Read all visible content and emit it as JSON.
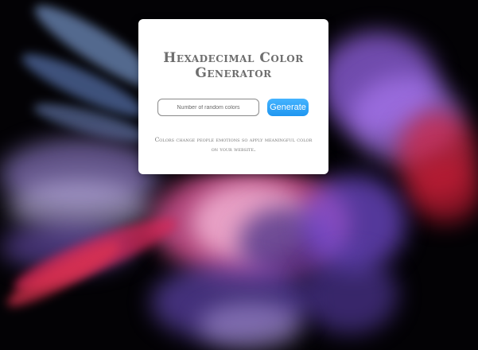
{
  "app": {
    "title": "Hexadecimal Color Generator",
    "input": {
      "placeholder": "Number of random colors",
      "value": ""
    },
    "generate_label": "Generate",
    "tagline": "Colors change people emotions so apply meaningful color on your website."
  },
  "colors": {
    "background": "#030205",
    "card": "#ffffff",
    "button": "#2ea5f8",
    "powder_blue": "#7fa8e8",
    "powder_purple": "#8a5fd6",
    "powder_pink": "#e0407a",
    "powder_red": "#c81e3c"
  }
}
